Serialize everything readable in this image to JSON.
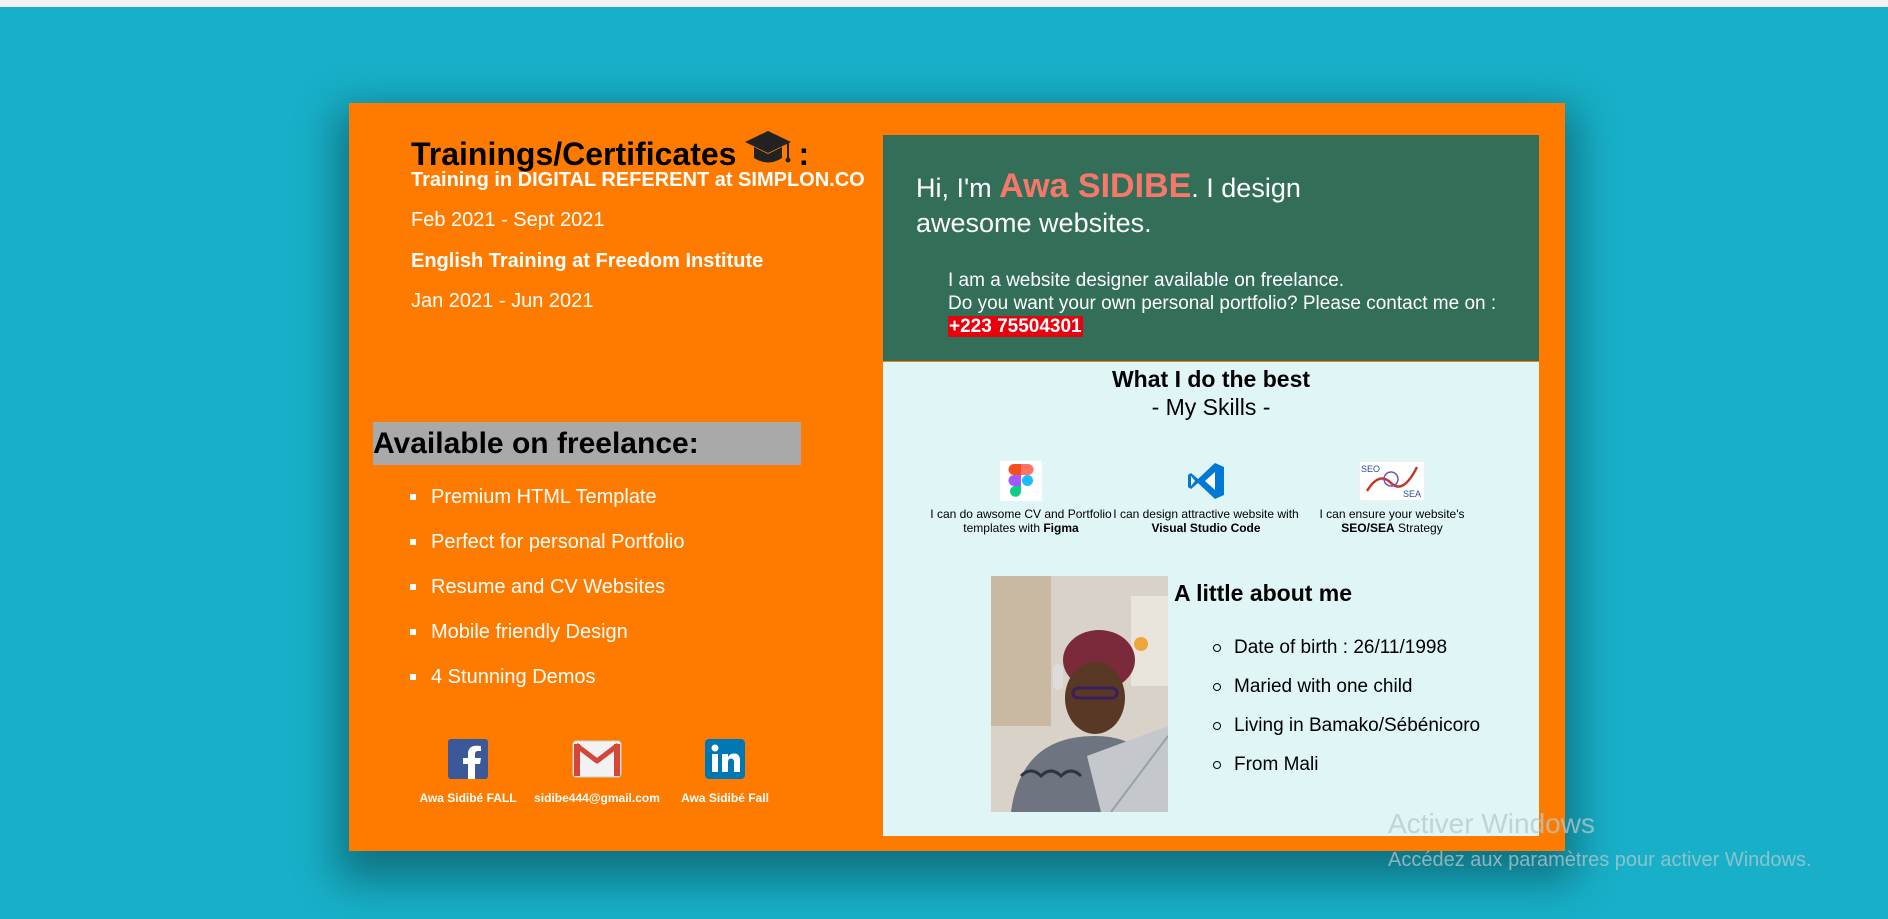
{
  "trainings": {
    "title": "Trainings/Certificates",
    "title_suffix": ":",
    "items": [
      {
        "text": "Training in DIGITAL REFERENT at SIMPLON.CO"
      },
      {
        "text": "Feb 2021 - Sept 2021"
      },
      {
        "text": "English Training at Freedom Institute"
      },
      {
        "text": "Jan 2021 - Jun 2021"
      }
    ]
  },
  "freelance": {
    "title": "Available on freelance:",
    "items": [
      "Premium HTML Template",
      "Perfect for personal Portfolio",
      "Resume and CV Websites",
      "Mobile friendly Design",
      "4 Stunning Demos"
    ]
  },
  "social": [
    {
      "label": "Awa Sidibé FALL",
      "icon": "facebook-icon"
    },
    {
      "label": "sidibe444@gmail.com",
      "icon": "gmail-icon"
    },
    {
      "label": "Awa Sidibé Fall",
      "icon": "linkedin-icon"
    }
  ],
  "hero": {
    "greeting": "Hi, I'm",
    "name": "Awa SIDIBE",
    "tagline": ". I design awesome websites.",
    "line1": "I am a website designer available on freelance.",
    "line2": "Do you want your own personal portfolio? Please contact me on :",
    "phone": "+223 75504301"
  },
  "skills": {
    "title": "What I do the best",
    "subtitle": "- My Skills -",
    "items": [
      {
        "pre": "I can do awsome CV and Portfolio templates with",
        "strong": "Figma",
        "post": "",
        "icon": "figma-icon"
      },
      {
        "pre": "I can design attractive website with",
        "strong": "Visual Studio Code",
        "post": "",
        "icon": "vscode-icon"
      },
      {
        "pre": "I can ensure your website's",
        "strong": "SEO/SEA",
        "post": "Strategy",
        "icon": "seo-sea-icon"
      }
    ]
  },
  "about": {
    "title": "A little about me",
    "items": [
      "Date of birth : 26/11/1998",
      "Maried with one child",
      "Living in Bamako/Sébénicoro",
      "From Mali"
    ]
  },
  "watermark": {
    "line1": "Activer Windows",
    "line2": "Accédez aux paramètres pour activer Windows."
  },
  "colors": {
    "background": "#17b0c8",
    "card": "#ff7b00",
    "hero": "#336e59",
    "skills_panel": "#e0f5f5",
    "name_accent": "#f7786b",
    "phone_highlight": "#e8000d",
    "freelance_bar": "#a9a9a9"
  }
}
